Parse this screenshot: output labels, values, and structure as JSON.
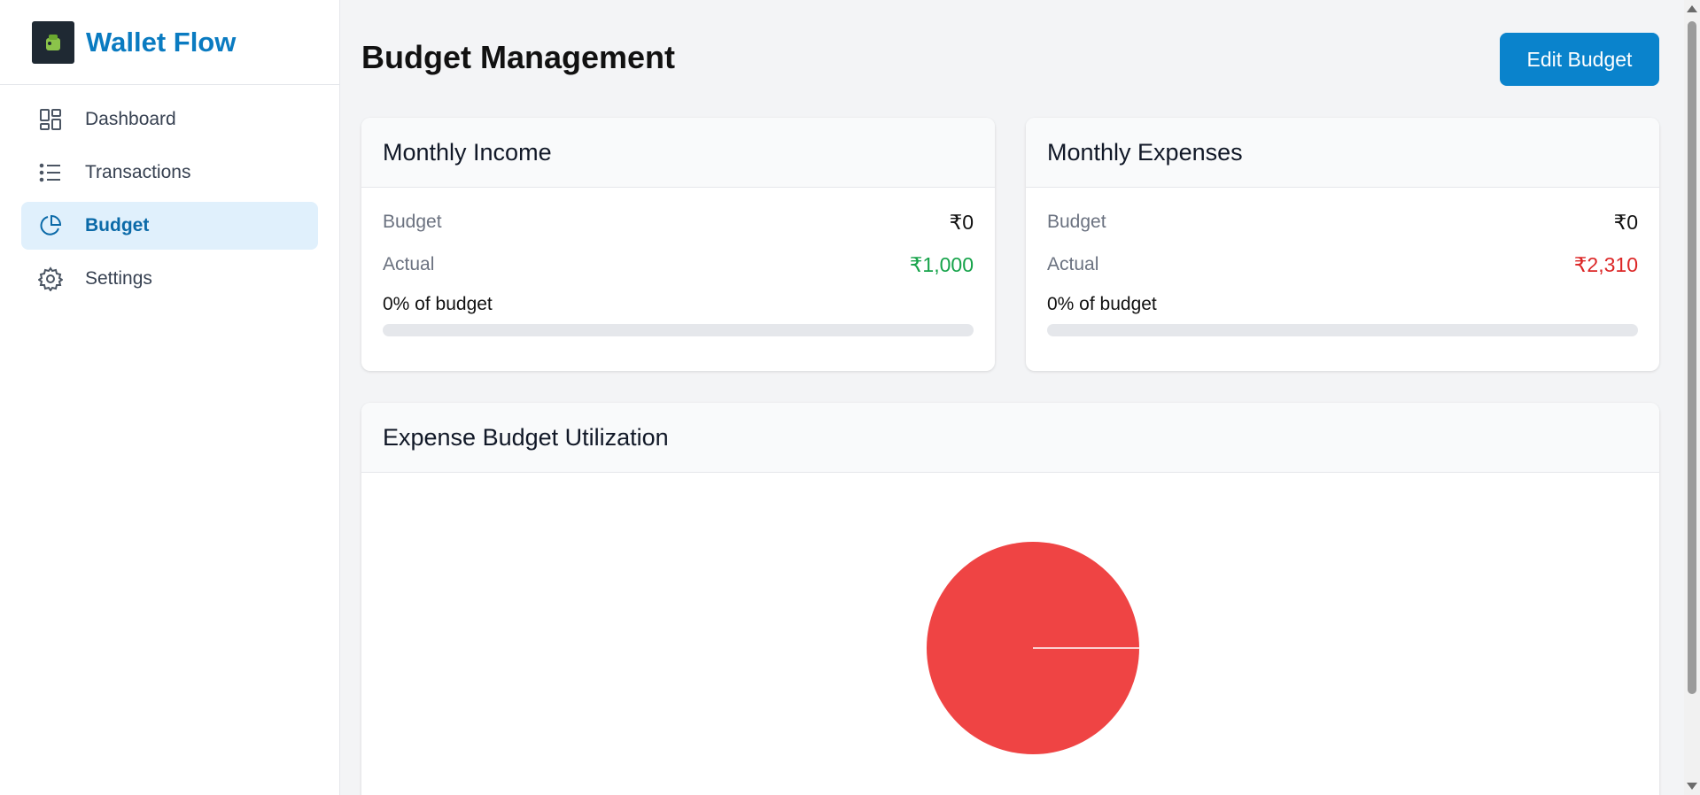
{
  "app": {
    "title": "Wallet Flow",
    "logo_icon": "wallet-icon"
  },
  "sidebar": {
    "items": [
      {
        "label": "Dashboard",
        "icon": "dashboard-icon",
        "active": false
      },
      {
        "label": "Transactions",
        "icon": "list-icon",
        "active": false
      },
      {
        "label": "Budget",
        "icon": "pie-chart-icon",
        "active": true
      },
      {
        "label": "Settings",
        "icon": "gear-icon",
        "active": false
      }
    ]
  },
  "header": {
    "title": "Budget Management",
    "edit_button": "Edit Budget"
  },
  "income": {
    "title": "Monthly Income",
    "budget_label": "Budget",
    "budget_value": "₹0",
    "actual_label": "Actual",
    "actual_value": "₹1,000",
    "percent_text": "0% of budget",
    "progress": 0
  },
  "expenses": {
    "title": "Monthly Expenses",
    "budget_label": "Budget",
    "budget_value": "₹0",
    "actual_label": "Actual",
    "actual_value": "₹2,310",
    "percent_text": "0% of budget",
    "progress": 0
  },
  "utilization": {
    "title": "Expense Budget Utilization"
  },
  "chart_data": {
    "type": "pie",
    "slices": [
      {
        "value": 100,
        "color": "#ef4444"
      }
    ]
  },
  "colors": {
    "accent": "#0a83cc",
    "positive": "#16a34a",
    "negative": "#dc2626",
    "pie": "#ef4444"
  }
}
